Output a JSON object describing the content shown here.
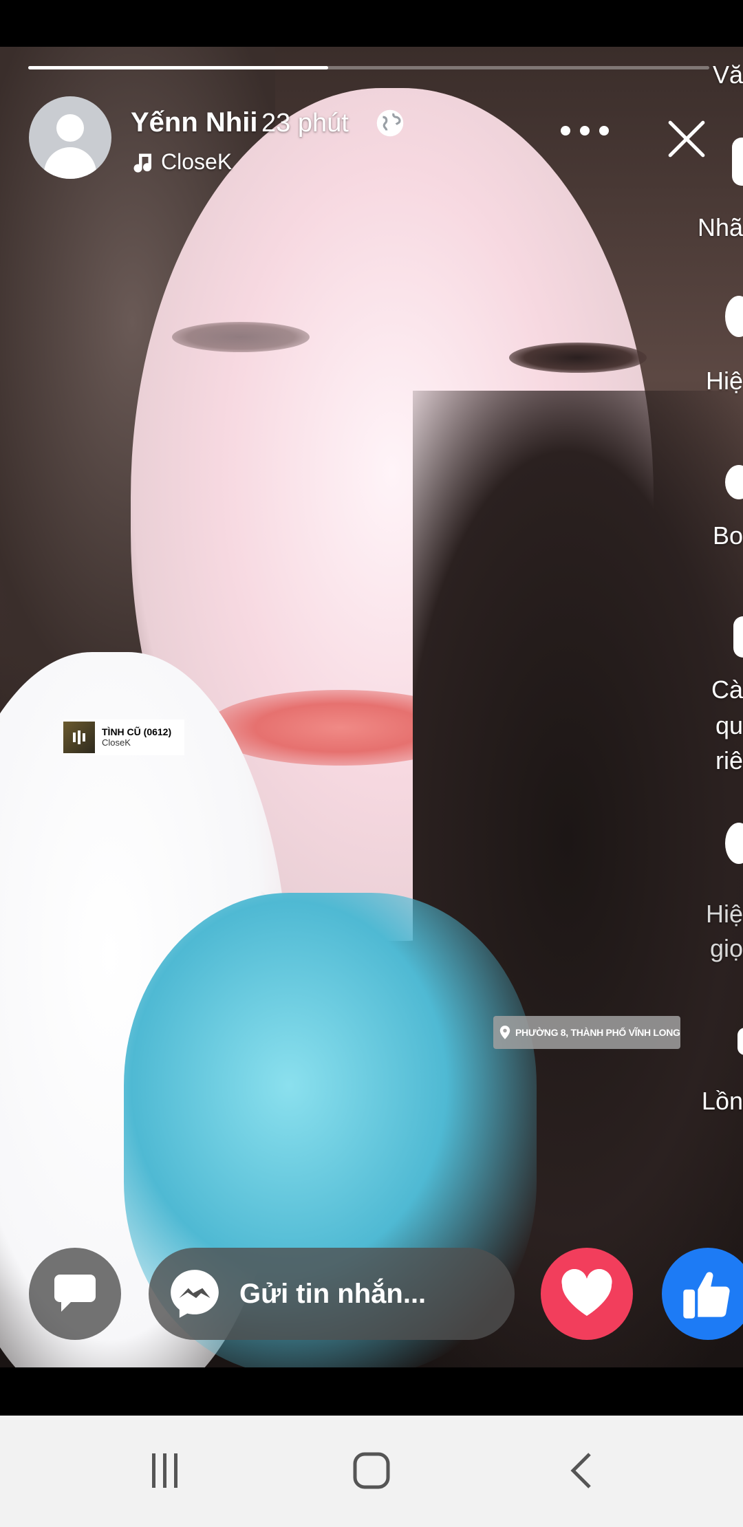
{
  "story": {
    "progress": 0.44,
    "user_name": "Yếnn Nhii",
    "time_ago": "23 phút",
    "song_artist": "CloseK"
  },
  "side_labels": [
    "Vă",
    "Nhã",
    "Hiệ",
    "Bo",
    "Cà",
    "qu",
    "riê",
    "Hiệ",
    "giọ",
    "Lồn"
  ],
  "music_sticker": {
    "title": "TÌNH CŨ (0612)",
    "artist": "CloseK"
  },
  "location_sticker": {
    "text": "PHƯỜNG 8, THÀNH PHỐ VĨNH LONG"
  },
  "message_bar": {
    "placeholder": "Gửi tin nhắn..."
  },
  "colors": {
    "heart": "#f23e5c",
    "like": "#1d7bf5",
    "pill": "#505050"
  },
  "icons": [
    "globe-icon",
    "music-note-icon",
    "more-icon",
    "close-icon",
    "chat-bubble-icon",
    "messenger-icon",
    "heart-icon",
    "thumbs-up-icon",
    "recents-icon",
    "home-icon",
    "back-icon"
  ]
}
